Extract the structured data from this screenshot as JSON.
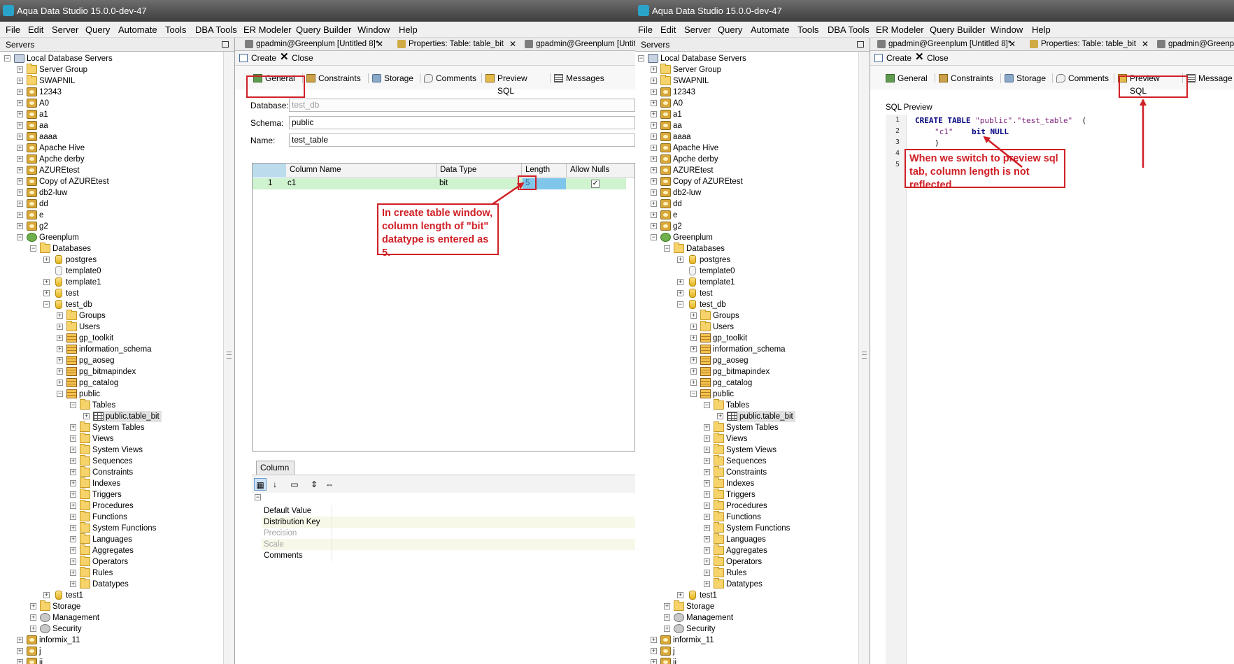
{
  "window": {
    "title": "Aqua Data Studio 15.0.0-dev-47"
  },
  "menu": [
    "File",
    "Edit",
    "Server",
    "Query",
    "Automate",
    "Tools",
    "DBA Tools",
    "ER Modeler",
    "Query Builder",
    "Window",
    "Help"
  ],
  "servers_panel": {
    "title": "Servers",
    "root": "Local Database Servers",
    "servers": [
      "Server Group",
      "SWAPNIL",
      "12343",
      "A0",
      "a1",
      "aa",
      "aaaa",
      "Apache Hive",
      "Apche derby",
      "AZUREtest",
      "Copy of AZUREtest",
      "db2-luw",
      "dd",
      "e",
      "g2"
    ],
    "greenplum": "Greenplum",
    "databases_label": "Databases",
    "databases": [
      "postgres",
      "template0",
      "template1",
      "test"
    ],
    "test_db": "test_db",
    "schemas": [
      "Groups",
      "Users",
      "gp_toolkit",
      "information_schema",
      "pg_aoseg",
      "pg_bitmapindex",
      "pg_catalog",
      "public"
    ],
    "tables_label": "Tables",
    "selected_table": "public.table_bit",
    "public_children": [
      "System Tables",
      "Views",
      "System Views",
      "Sequences",
      "Constraints",
      "Indexes",
      "Triggers",
      "Procedures",
      "Functions",
      "System Functions",
      "Languages",
      "Aggregates",
      "Operators",
      "Rules",
      "Datatypes"
    ],
    "after_test_db": "test1",
    "greenplum_more": [
      "Storage",
      "Management",
      "Security"
    ],
    "after_greenplum": [
      "informix_11",
      "j",
      "jj"
    ]
  },
  "doc_tabs": {
    "left": [
      "gpadmin@Greenplum [Untitled 8]*",
      "Properties: Table: table_bit",
      "gpadmin@Greenplum [Untitled"
    ],
    "right": [
      "gpadmin@Greenplum [Untitled 8]*",
      "Properties: Table: table_bit",
      "gpadmin@Greenplum"
    ],
    "close_glyph": "✕"
  },
  "toolbar": {
    "create": "Create",
    "close": "Close"
  },
  "subtabs": {
    "general": "General",
    "constraints": "Constraints",
    "storage": "Storage",
    "comments": "Comments",
    "preview_sql": "Preview SQL",
    "messages_left": "Messages",
    "messages_right": "Message"
  },
  "form": {
    "database_label": "Database:",
    "database_value": "test_db",
    "schema_label": "Schema:",
    "schema_value": "public",
    "name_label": "Name:",
    "name_value": "test_table"
  },
  "columns_grid": {
    "headers": [
      "Column Name",
      "Data Type",
      "Length",
      "Allow Nulls"
    ],
    "rows": [
      {
        "num": "1",
        "name": "c1",
        "type": "bit",
        "length": "5",
        "allow_nulls": "✓"
      }
    ]
  },
  "column_panel": {
    "tab": "Column",
    "properties": [
      "Default Value",
      "Distribution Key",
      "Precision",
      "Scale",
      "Comments"
    ]
  },
  "sql_preview": {
    "label": "SQL Preview",
    "line_numbers": [
      "1",
      "2",
      "3",
      "4",
      "5"
    ],
    "line1_kw": "CREATE TABLE",
    "line1_str": "\"public\".\"test_table\"",
    "line1_tail": "  (",
    "line2_str": "\"c1\"",
    "line2_kw": "bit NULL",
    "line3": ")"
  },
  "annotations": {
    "left": "In create table window, column length of \"bit\" datatype is entered as 5.",
    "right": "When we switch to preview sql tab, column length is not reflected"
  },
  "colors": {
    "annotation": "#d02027",
    "grid_row": "#cff2cf",
    "length_cell": "#7fc6ea"
  }
}
